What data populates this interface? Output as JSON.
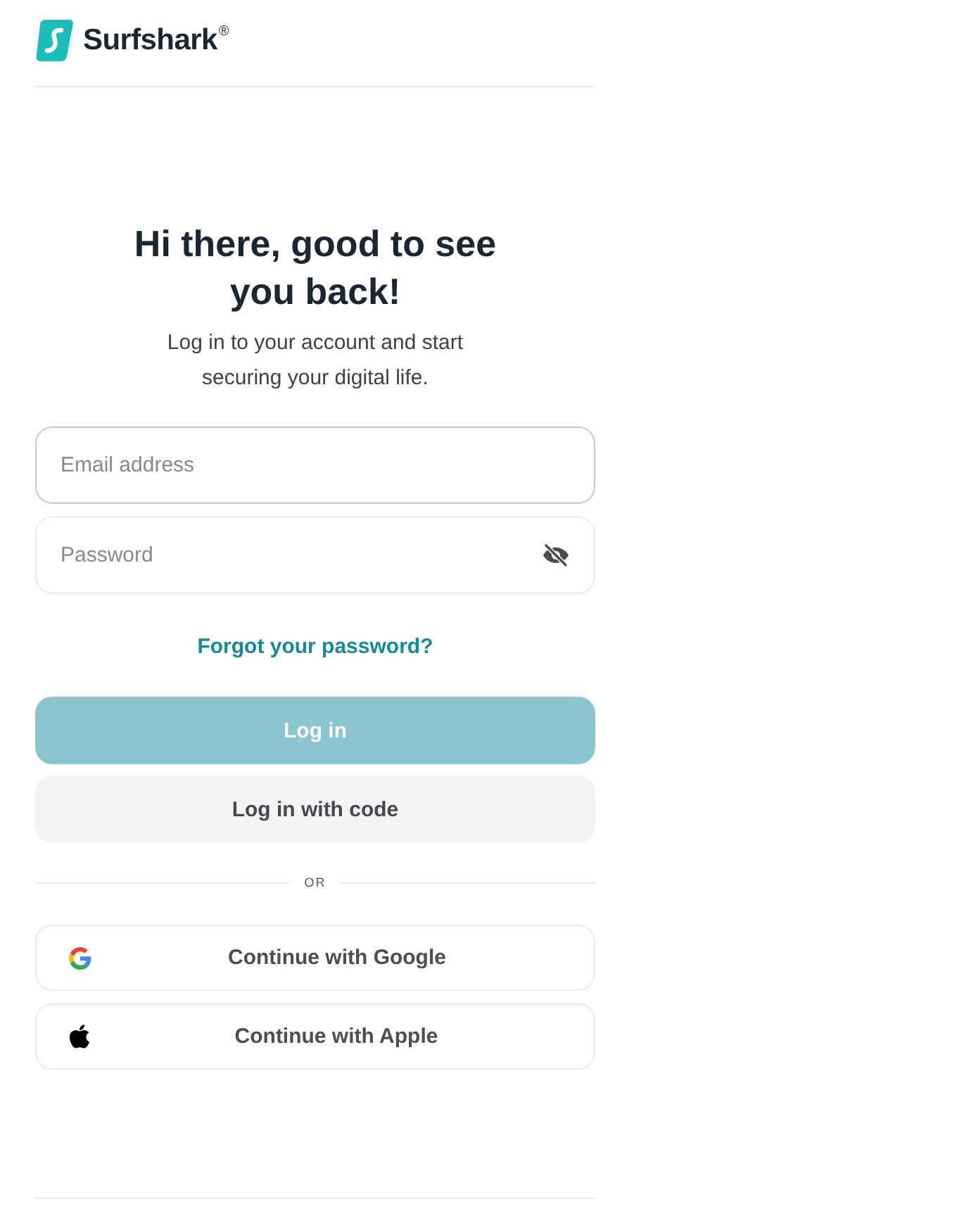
{
  "header": {
    "brand": "Surfshark$^{®}$"
  },
  "login": {
    "title": "Hi there, good to see you back!",
    "subtitle": "Log in to your account and start securing your digital life.",
    "fields": [
      {
        "kind": "email",
        "placeholder": "Email address",
        "focused": true
      },
      {
        "kind": "password",
        "placeholder": "Password",
        "focused": false,
        "visible": false
      }
    ],
    "forgot_link": "Forgot your password?",
    "buttons": [
      {
        "kind": "primary",
        "label": "Log in",
        "disabled": true
      },
      {
        "kind": "secondary",
        "label": "Log in with code",
        "disabled": false
      }
    ],
    "divider": "OR",
    "social_buttons": [
      {
        "kind": "google",
        "label": "Continue with Google"
      },
      {
        "kind": "apple",
        "label": "Continue with Apple"
      }
    ]
  }
}
